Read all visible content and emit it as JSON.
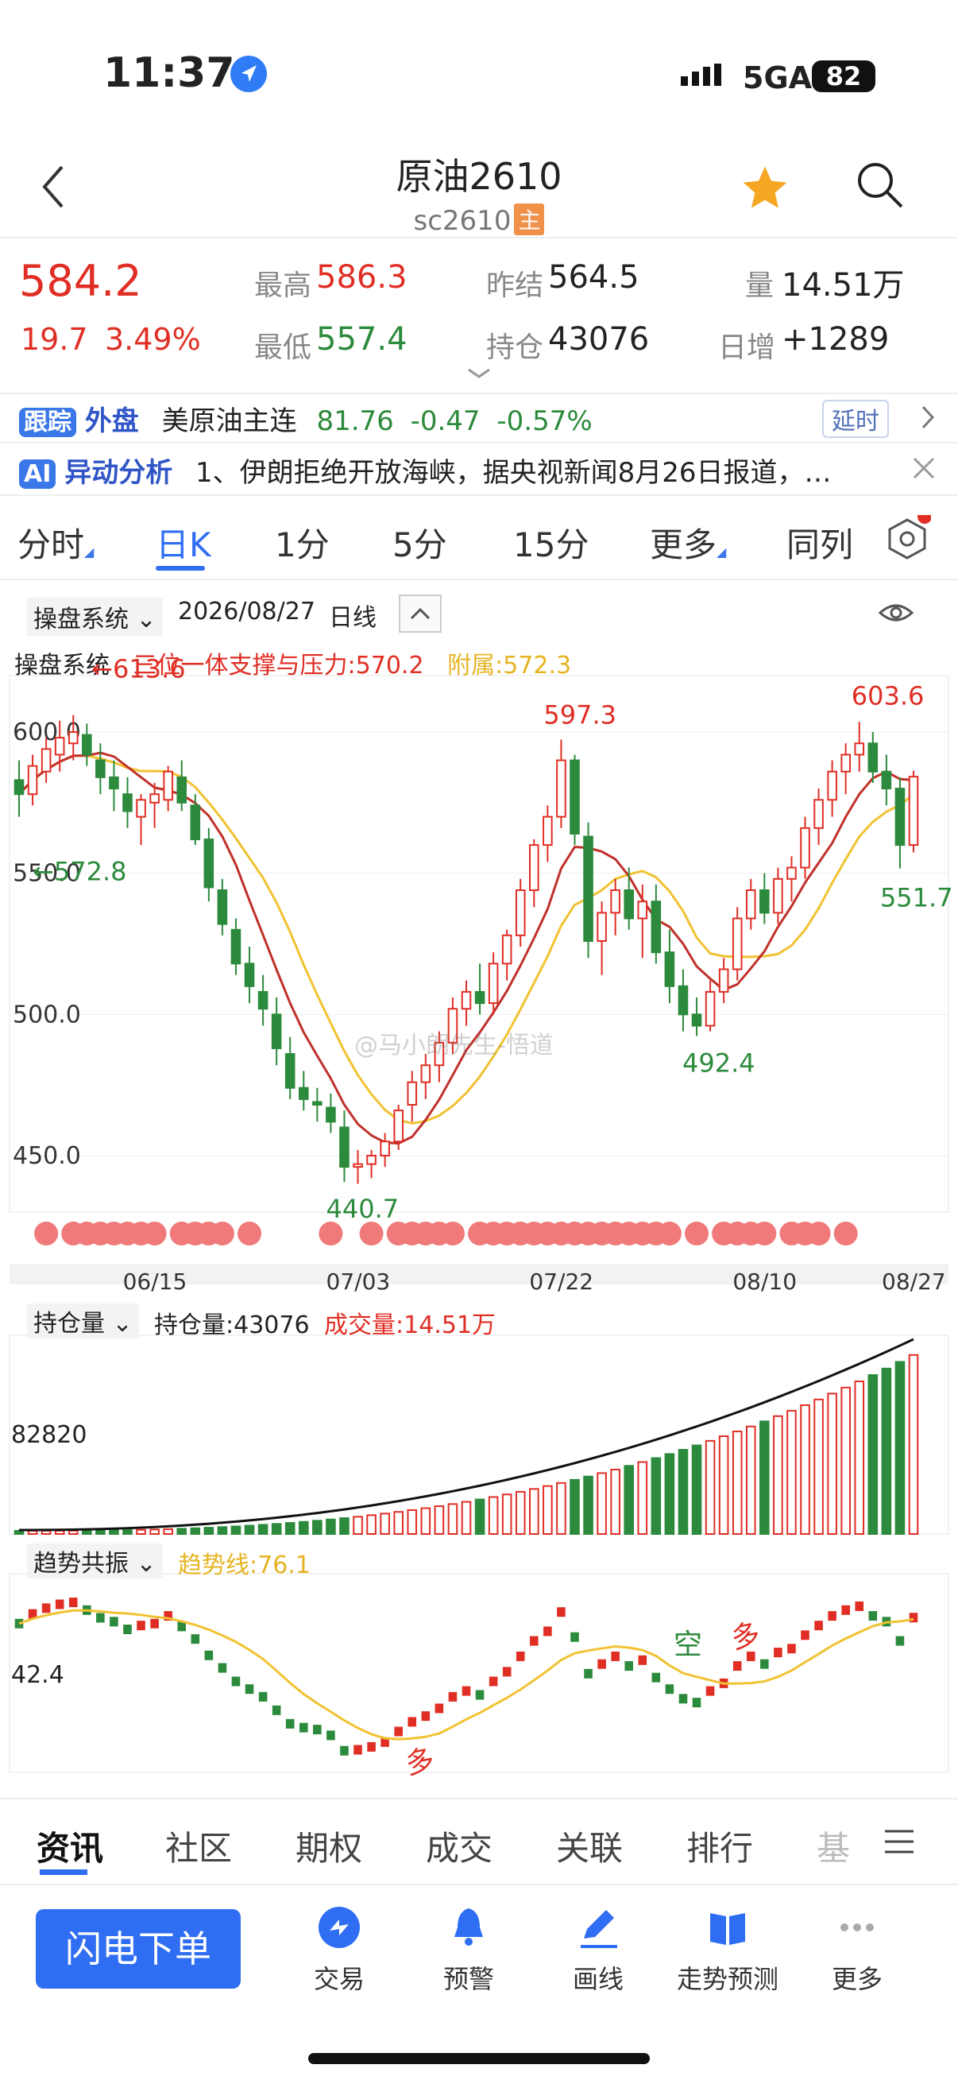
{
  "status": {
    "time": "11:37",
    "network": "5GA",
    "battery": "82"
  },
  "header": {
    "title": "原油2610",
    "subtitle": "sc2610",
    "main_badge": "主"
  },
  "quote": {
    "price": "584.2",
    "change": "19.7",
    "change_pct": "3.49%",
    "high_label": "最高",
    "high": "586.3",
    "low_label": "最低",
    "low": "557.4",
    "prev_settle_label": "昨结",
    "prev_settle": "564.5",
    "oi_label": "持仓",
    "oi": "43076",
    "volume_label": "量",
    "volume": "14.51万",
    "daily_inc_label": "日增",
    "daily_inc": "+1289"
  },
  "tracking": {
    "badge": "跟踪",
    "market": "外盘",
    "name": "美原油主连",
    "price": "81.76",
    "change": "-0.47",
    "change_pct": "-0.57%",
    "delay": "延时"
  },
  "ai_news": {
    "badge": "AI",
    "title": "异动分析",
    "text": "1、伊朗拒绝开放海峡，据央视新闻8月26日报道，…"
  },
  "tabs": [
    {
      "label": "分时"
    },
    {
      "label": "日K"
    },
    {
      "label": "1分"
    },
    {
      "label": "5分"
    },
    {
      "label": "15分"
    },
    {
      "label": "更多"
    },
    {
      "label": "同列"
    }
  ],
  "chart_header": {
    "system": "操盘系统",
    "date": "2026/08/27",
    "period": "日线"
  },
  "indicator": {
    "name": "操盘系统",
    "line1": "三位一体支撑与压力:570.2",
    "line2": "附属:572.3"
  },
  "watermark": "@马小朗先生-悟道",
  "chart_data": [
    {
      "type": "candlestick",
      "title": "",
      "ylim": [
        430,
        620
      ],
      "y_ticks": [
        "600.0",
        "550.0",
        "500.0",
        "450.0"
      ],
      "x_ticks": [
        "06/15",
        "07/03",
        "07/22",
        "08/10",
        "08/27"
      ],
      "annotations": [
        {
          "text": "←613.6",
          "y": 613.6
        },
        {
          "text": "←572.8",
          "y": 572.8
        },
        {
          "text": "597.3",
          "y": 597.3
        },
        {
          "text": "440.7",
          "y": 440.7
        },
        {
          "text": "492.4",
          "y": 492.4
        },
        {
          "text": "603.6",
          "y": 603.6
        },
        {
          "text": "551.7",
          "y": 551.7
        }
      ],
      "candles": [
        [
          583,
          590,
          570,
          578
        ],
        [
          578,
          592,
          574,
          588
        ],
        [
          586,
          598,
          582,
          594
        ],
        [
          592,
          604,
          586,
          598
        ],
        [
          596,
          606,
          590,
          600
        ],
        [
          599,
          603,
          588,
          592
        ],
        [
          590,
          596,
          578,
          584
        ],
        [
          584,
          590,
          572,
          580
        ],
        [
          578,
          584,
          566,
          572
        ],
        [
          570,
          578,
          560,
          576
        ],
        [
          575,
          582,
          566,
          578
        ],
        [
          576,
          588,
          572,
          586
        ],
        [
          584,
          590,
          572,
          575
        ],
        [
          574,
          578,
          560,
          562
        ],
        [
          562,
          566,
          540,
          545
        ],
        [
          544,
          548,
          528,
          532
        ],
        [
          530,
          534,
          514,
          518
        ],
        [
          518,
          524,
          504,
          510
        ],
        [
          508,
          514,
          496,
          502
        ],
        [
          500,
          506,
          482,
          488
        ],
        [
          486,
          492,
          470,
          474
        ],
        [
          474,
          480,
          466,
          470
        ],
        [
          469,
          474,
          462,
          468
        ],
        [
          467,
          472,
          458,
          462
        ],
        [
          460,
          466,
          440.7,
          446
        ],
        [
          446,
          452,
          440,
          447
        ],
        [
          447,
          452,
          442,
          450
        ],
        [
          450,
          458,
          446,
          455
        ],
        [
          455,
          468,
          452,
          466
        ],
        [
          468,
          480,
          462,
          476
        ],
        [
          476,
          486,
          470,
          482
        ],
        [
          482,
          494,
          476,
          490
        ],
        [
          490,
          506,
          486,
          502
        ],
        [
          502,
          512,
          496,
          508
        ],
        [
          508,
          518,
          500,
          504
        ],
        [
          504,
          522,
          500,
          518
        ],
        [
          518,
          530,
          512,
          528
        ],
        [
          528,
          548,
          524,
          544
        ],
        [
          544,
          562,
          538,
          560
        ],
        [
          560,
          574,
          554,
          570
        ],
        [
          570,
          597.3,
          566,
          590
        ],
        [
          590,
          592,
          560,
          564
        ],
        [
          563,
          568,
          520,
          526
        ],
        [
          526,
          540,
          514,
          536
        ],
        [
          536,
          548,
          528,
          544
        ],
        [
          544,
          552,
          530,
          534
        ],
        [
          534,
          546,
          520,
          540
        ],
        [
          540,
          546,
          518,
          522
        ],
        [
          522,
          530,
          504,
          510
        ],
        [
          510,
          516,
          494,
          500
        ],
        [
          500,
          506,
          492.4,
          496
        ],
        [
          496,
          512,
          494,
          508
        ],
        [
          508,
          520,
          504,
          516
        ],
        [
          516,
          538,
          512,
          534
        ],
        [
          534,
          548,
          530,
          544
        ],
        [
          544,
          550,
          532,
          536
        ],
        [
          536,
          552,
          532,
          548
        ],
        [
          548,
          556,
          540,
          552
        ],
        [
          552,
          570,
          548,
          566
        ],
        [
          566,
          580,
          560,
          576
        ],
        [
          576,
          590,
          570,
          586
        ],
        [
          586,
          596,
          578,
          592
        ],
        [
          592,
          603.6,
          586,
          596
        ],
        [
          596,
          600,
          582,
          586
        ],
        [
          586,
          592,
          574,
          580
        ],
        [
          580,
          584,
          551.7,
          560
        ],
        [
          560,
          586.3,
          557.4,
          584.2
        ]
      ],
      "series": [
        {
          "name": "三位一体支撑与压力",
          "color": "#c0302a"
        },
        {
          "name": "附属",
          "color": "#f1c232"
        }
      ]
    },
    {
      "type": "bar",
      "title": "",
      "series": [
        {
          "name": "持仓量",
          "value": "43076"
        },
        {
          "name": "成交量",
          "value": "14.51万"
        }
      ],
      "y_ticks": [
        "82820"
      ]
    },
    {
      "type": "bar",
      "title": "",
      "series": [
        {
          "name": "趋势线",
          "value": "76.1"
        }
      ],
      "y_ticks": [
        "42.4"
      ],
      "labels": [
        "多",
        "空",
        "多"
      ]
    }
  ],
  "sub1": {
    "select": "持仓量",
    "oi_text": "持仓量:43076",
    "vol_text": "成交量:14.51万",
    "ytick": "82820"
  },
  "sub2": {
    "select": "趋势共振",
    "trend_text": "趋势线:76.1",
    "ytick": "42.4",
    "labels": [
      "多",
      "空",
      "多"
    ]
  },
  "bottom_tabs": [
    {
      "label": "资讯"
    },
    {
      "label": "社区"
    },
    {
      "label": "期权"
    },
    {
      "label": "成交"
    },
    {
      "label": "关联"
    },
    {
      "label": "排行"
    },
    {
      "label": "基"
    }
  ],
  "actions": {
    "order": "闪电下单",
    "items": [
      {
        "label": "交易"
      },
      {
        "label": "预警"
      },
      {
        "label": "画线"
      },
      {
        "label": "走势预测"
      },
      {
        "label": "更多"
      }
    ]
  },
  "colors": {
    "up": "#e02e24",
    "down": "#2c8a3c",
    "accent": "#2f6ef2"
  }
}
